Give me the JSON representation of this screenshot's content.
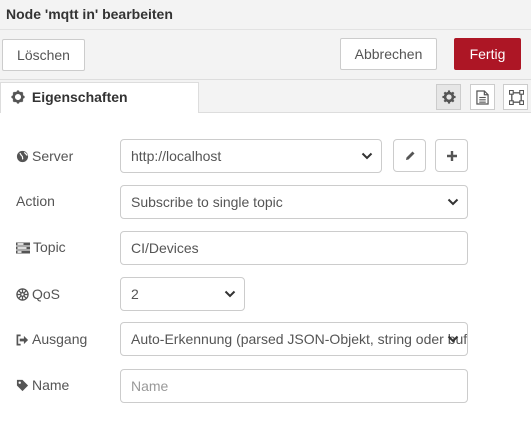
{
  "dialog": {
    "title": "Node 'mqtt in' bearbeiten"
  },
  "toolbar": {
    "delete_label": "Löschen",
    "cancel_label": "Abbrechen",
    "done_label": "Fertig",
    "done_color": "#ad1625"
  },
  "tabs": {
    "properties_label": "Eigenschaften"
  },
  "form": {
    "server": {
      "label": "Server",
      "value": "http://localhost"
    },
    "action": {
      "label": "Action",
      "value": "Subscribe to single topic"
    },
    "topic": {
      "label": "Topic",
      "value": "CI/Devices"
    },
    "qos": {
      "label": "QoS",
      "value": "2"
    },
    "output": {
      "label": "Ausgang",
      "value": "Auto-Erkennung (parsed JSON-Objekt, string oder buffer)"
    },
    "name": {
      "label": "Name",
      "placeholder": "Name",
      "value": ""
    }
  }
}
